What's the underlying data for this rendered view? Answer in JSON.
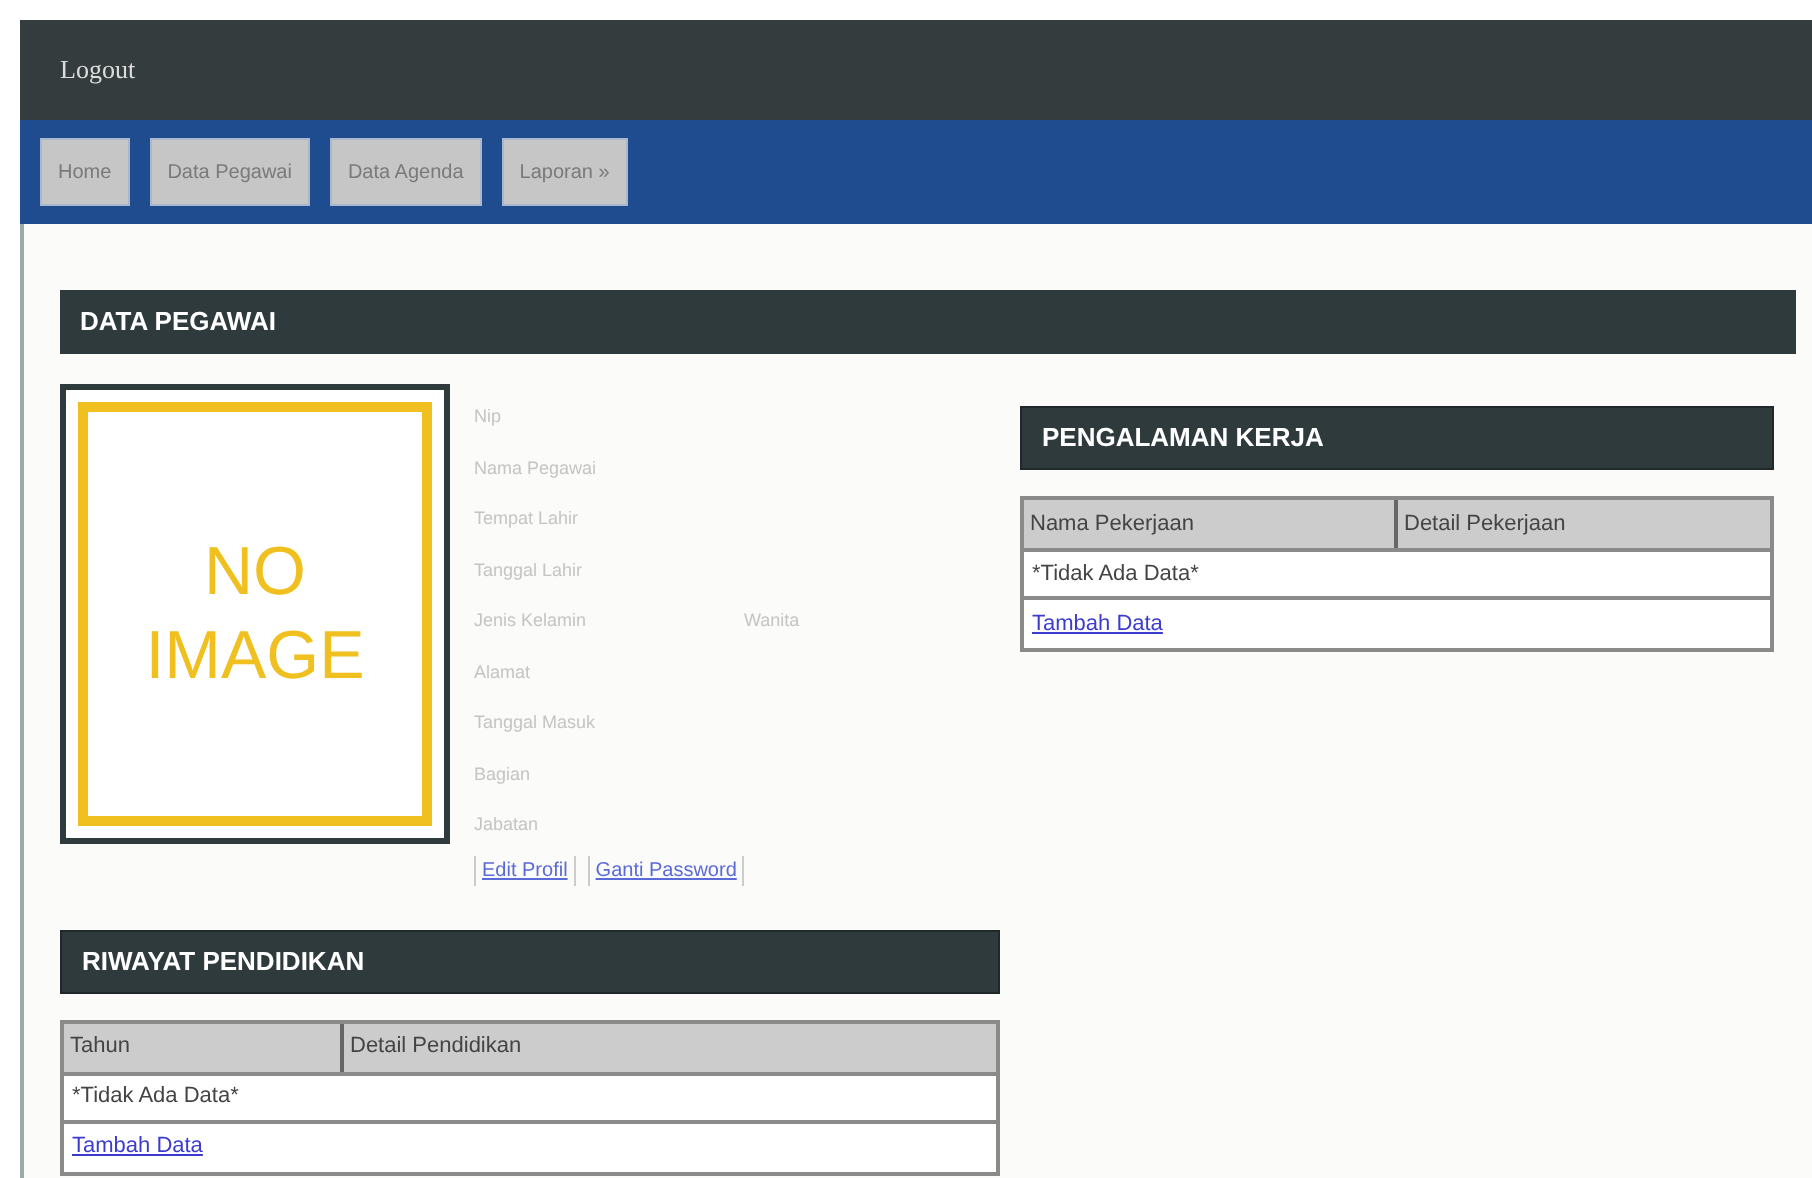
{
  "header": {
    "title": "Logout"
  },
  "nav": [
    {
      "label": "Home"
    },
    {
      "label": "Data Pegawai"
    },
    {
      "label": "Data Agenda"
    },
    {
      "label": "Laporan »"
    }
  ],
  "data_pegawai": {
    "title": "DATA PEGAWAI",
    "photo": {
      "text": [
        "NO",
        "IMAGE"
      ]
    },
    "fields": [
      {
        "label": "Nip"
      },
      {
        "label": "Nama Pegawai"
      },
      {
        "label": "Tempat Lahir"
      },
      {
        "label": "Tanggal Lahir"
      },
      {
        "label": "Jenis Kelamin",
        "value": "Wanita"
      },
      {
        "label": "Alamat"
      },
      {
        "label": "Tanggal Masuk"
      },
      {
        "label": "Bagian"
      },
      {
        "label": "Jabatan"
      }
    ],
    "links": [
      "Edit Profil",
      "Ganti Password"
    ]
  },
  "pengalaman_kerja": {
    "title": "PENGALAMAN KERJA",
    "columns": [
      "Nama Pekerjaan",
      "Detail Pekerjaan"
    ],
    "empty": "*Tidak Ada Data*",
    "add_link": "Tambah Data"
  },
  "riwayat_pendidikan": {
    "title": "RIWAYAT PENDIDIKAN",
    "columns": [
      "Tahun",
      "Detail Pendidikan"
    ],
    "empty": "*Tidak Ada Data*",
    "add_link": "Tambah Data"
  }
}
